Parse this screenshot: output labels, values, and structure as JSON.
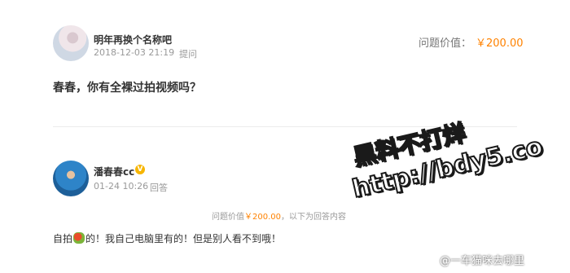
{
  "question": {
    "asker_name": "明年再换个名称吧",
    "time": "2018-12-03 21:19",
    "action": "提问",
    "price_label": "问题价值：",
    "price_value": "￥200.00",
    "text": "春春，你有全裸过拍视频吗？"
  },
  "answer": {
    "answerer_name": "潘春春cc",
    "verified_badge": "V",
    "time": "01-24 10:26",
    "action": "回答",
    "notice_prefix": "问题价值",
    "notice_amount": "￥200.00",
    "notice_suffix": "，以下为回答内容",
    "text_before": "自拍",
    "text_after": "的！我自己电脑里有的！但是别人看不到哦！"
  },
  "watermark": {
    "line1": "黑料不打烊",
    "line2": "http://bdy5.co"
  },
  "weibo_mark": "@一车猫咪去哪里"
}
